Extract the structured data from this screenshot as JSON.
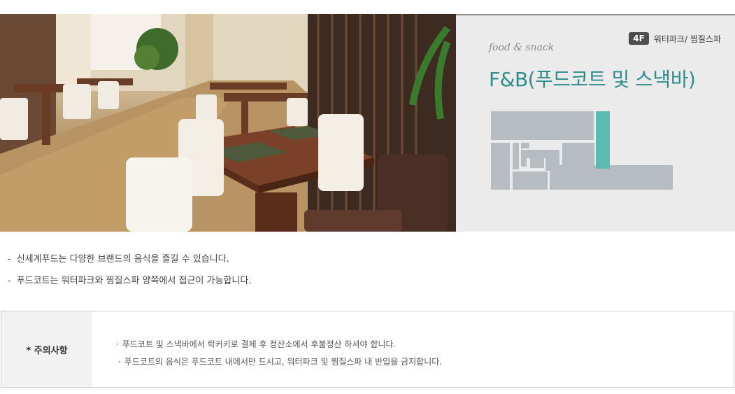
{
  "banner": {
    "floor_badge": "4F",
    "floor_area": "워터파크/ 찜질스파",
    "sub_title": "food & snack",
    "main_title": "F&B(푸드코트 및 스낵바)",
    "highlight_color": "#5bbab1",
    "map_color": "#b7bcc0"
  },
  "description": [
    "신세계푸드는 다양한 브랜드의 음식을 즐길 수 있습니다.",
    "푸드코트는 워터파크와 찜질스파 양쪽에서 접근이 가능합니다."
  ],
  "notice": {
    "title": "* 주의사항",
    "items": [
      "푸드코트 및 스낵바에서 락커키로 결제 후 정산소에서 후불정산 하셔야 합니다.",
      "푸드코트의 음식은 푸드코트 내에서만 드시고, 워터파크 및 찜질스파 내 반입을 금지합니다."
    ]
  }
}
